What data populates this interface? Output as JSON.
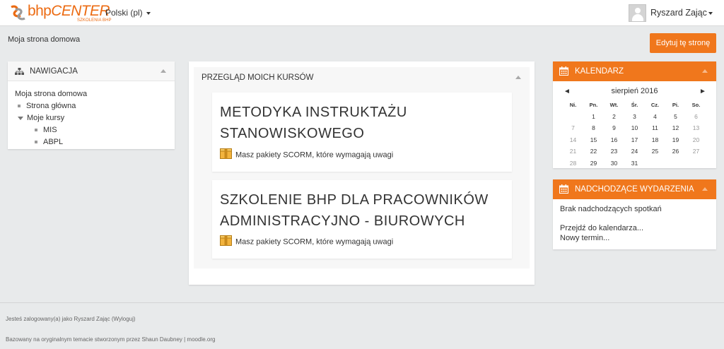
{
  "header": {
    "logo": {
      "brand_prefix": "bhp",
      "brand_name": "CENTER",
      "tagline": "SZKOLENIA BHP"
    },
    "language": "Polski (pl)",
    "user_name": "Ryszard Zając"
  },
  "page": {
    "breadcrumb": "Moja strona domowa",
    "edit_button": "Edytuj tę stronę"
  },
  "navigation": {
    "title": "NAWIGACJA",
    "home": "Moja strona domowa",
    "site_home": "Strona główna",
    "my_courses": "Moje kursy",
    "courses": [
      "MIS",
      "ABPL"
    ]
  },
  "overview": {
    "title": "PRZEGLĄD MOICH KURSÓW",
    "courses": [
      {
        "line1": "METODYKA INSTRUKTAŻU",
        "line2": "STANOWISKOWEGO",
        "notice": "Masz pakiety SCORM, które wymagają uwagi"
      },
      {
        "line1": "SZKOLENIE BHP DLA PRACOWNIKÓW",
        "line2": "ADMINISTRACYJNO - BIUROWYCH",
        "notice": "Masz pakiety SCORM, które wymagają uwagi"
      }
    ]
  },
  "calendar": {
    "title": "KALENDARZ",
    "prev": "◄",
    "next": "►",
    "month": "sierpień 2016",
    "weekdays": [
      "Ni.",
      "Pn.",
      "Wt.",
      "Śr.",
      "Cz.",
      "Pi.",
      "So."
    ],
    "weeks": [
      [
        "",
        "1",
        "2",
        "3",
        "4",
        "5",
        "6"
      ],
      [
        "7",
        "8",
        "9",
        "10",
        "11",
        "12",
        "13"
      ],
      [
        "14",
        "15",
        "16",
        "17",
        "18",
        "19",
        "20"
      ],
      [
        "21",
        "22",
        "23",
        "24",
        "25",
        "26",
        "27"
      ],
      [
        "28",
        "29",
        "30",
        "31",
        "",
        "",
        ""
      ]
    ]
  },
  "events": {
    "title": "NADCHODZĄCE WYDARZENIA",
    "none": "Brak nadchodzących spotkań",
    "goto_calendar": "Przejdź do kalendarza...",
    "new_event": "Nowy termin..."
  },
  "footer": {
    "logged_in": "Jesteś zalogowany(a) jako Ryszard Zając (Wyloguj)",
    "credit": "Bazowany na oryginalnym temacie stworzonym przez Shaun Daubney | moodle.org"
  },
  "colors": {
    "accent": "#f0771c",
    "background": "#e8eaeb"
  },
  "icons": {
    "logo": "bhp-logo-mark",
    "navigation": "sitemap-icon",
    "calendar": "calendar-icon",
    "scorm": "package-icon",
    "user": "avatar",
    "collapse": "collapse-icon"
  }
}
